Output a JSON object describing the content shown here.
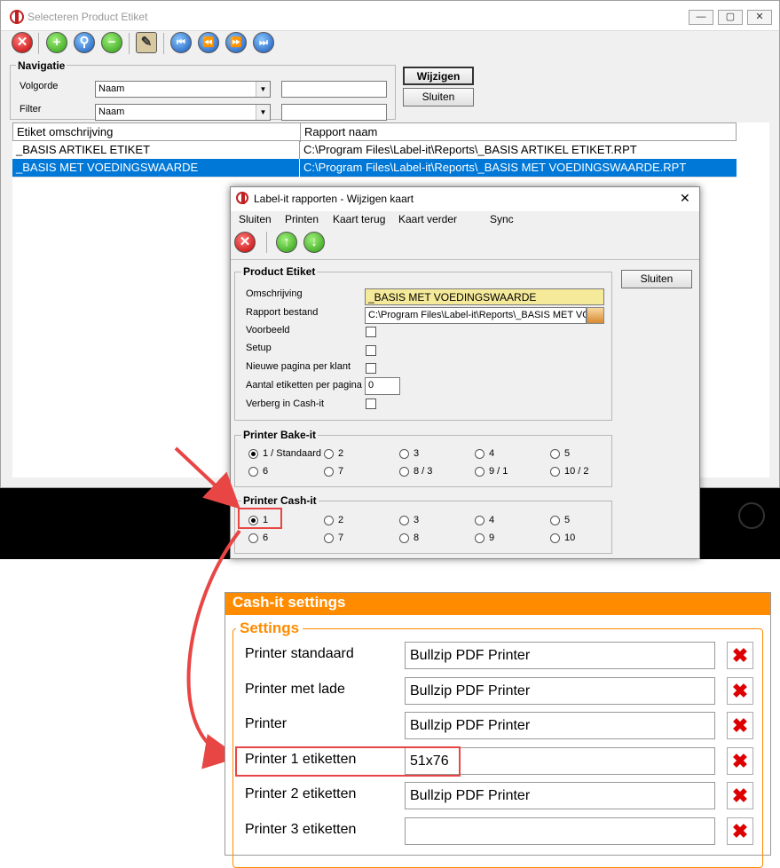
{
  "main_window": {
    "title": "Selecteren Product Etiket",
    "controls": {
      "minimize": "—",
      "maximize": "▢",
      "close": "✕"
    },
    "toolbar": [
      {
        "name": "close-icon",
        "glyph": "✕",
        "color": "red"
      },
      {
        "name": "add-icon",
        "glyph": "+",
        "color": "green"
      },
      {
        "name": "search-icon",
        "glyph": "⚲",
        "color": "blue"
      },
      {
        "name": "remove-icon",
        "glyph": "−",
        "color": "green"
      },
      {
        "name": "edit-icon",
        "glyph": "✎",
        "color": "clip"
      },
      {
        "name": "first-icon",
        "glyph": "⏮",
        "color": "blue"
      },
      {
        "name": "prev-icon",
        "glyph": "⏪",
        "color": "blue"
      },
      {
        "name": "next-icon",
        "glyph": "⏩",
        "color": "blue"
      },
      {
        "name": "last-icon",
        "glyph": "⏭",
        "color": "blue"
      }
    ],
    "navigatie": {
      "title": "Navigatie",
      "volgorde_label": "Volgorde",
      "volgorde_value": "Naam",
      "filter_label": "Filter",
      "filter_value": "Naam",
      "volgorde_search": "",
      "filter_search": ""
    },
    "buttons": {
      "wijzigen": "Wijzigen",
      "sluiten": "Sluiten"
    },
    "table": {
      "headers": [
        "Etiket omschrijving",
        "Rapport naam"
      ],
      "rows": [
        [
          "_BASIS ARTIKEL ETIKET",
          "C:\\Program Files\\Label-it\\Reports\\_BASIS ARTIKEL ETIKET.RPT"
        ],
        [
          "_BASIS MET VOEDINGSWAARDE",
          "C:\\Program Files\\Label-it\\Reports\\_BASIS MET VOEDINGSWAARDE.RPT"
        ]
      ],
      "selected_row": 1
    }
  },
  "dialog": {
    "title": "Label-it rapporten - Wijzigen kaart",
    "close": "✕",
    "menu": [
      "Sluiten",
      "Printen",
      "Kaart terug",
      "Kaart verder",
      "Sync"
    ],
    "side_button": "Sluiten",
    "product_etiket": {
      "title": "Product Etiket",
      "omschrijving_label": "Omschrijving",
      "omschrijving_value": "_BASIS MET VOEDINGSWAARDE",
      "rapport_label": "Rapport bestand",
      "rapport_value": "C:\\Program Files\\Label-it\\Reports\\_BASIS MET VO",
      "voorbeeld_label": "Voorbeeld",
      "setup_label": "Setup",
      "nieuwe_pagina_label": "Nieuwe pagina per klant",
      "aantal_label": "Aantal etiketten per pagina",
      "aantal_value": "0",
      "verberg_label": "Verberg in Cash-it"
    },
    "printer_bakeit": {
      "title": "Printer Bake-it",
      "options": [
        "1 / Standaard",
        "2",
        "3",
        "4",
        "5",
        "6",
        "7",
        "8 / 3",
        "9 / 1",
        "10 / 2"
      ],
      "selected": 0
    },
    "printer_cashit": {
      "title": "Printer Cash-it",
      "options": [
        "1",
        "2",
        "3",
        "4",
        "5",
        "6",
        "7",
        "8",
        "9",
        "10"
      ],
      "selected": 0
    }
  },
  "cashit": {
    "header": "Cash-it settings",
    "section": "Settings",
    "rows": [
      {
        "label": "Printer standaard",
        "value": "Bullzip PDF Printer"
      },
      {
        "label": "Printer met lade",
        "value": "Bullzip PDF Printer"
      },
      {
        "label": "Printer",
        "value": "Bullzip PDF Printer"
      },
      {
        "label": "Printer 1 etiketten",
        "value": "51x76"
      },
      {
        "label": "Printer 2 etiketten",
        "value": "Bullzip PDF Printer"
      },
      {
        "label": "Printer 3 etiketten",
        "value": ""
      }
    ],
    "delete_glyph": "✖"
  },
  "colors": {
    "selection": "#0078d7",
    "accent_orange": "#ff8c00",
    "annotation_red": "#e84545"
  }
}
